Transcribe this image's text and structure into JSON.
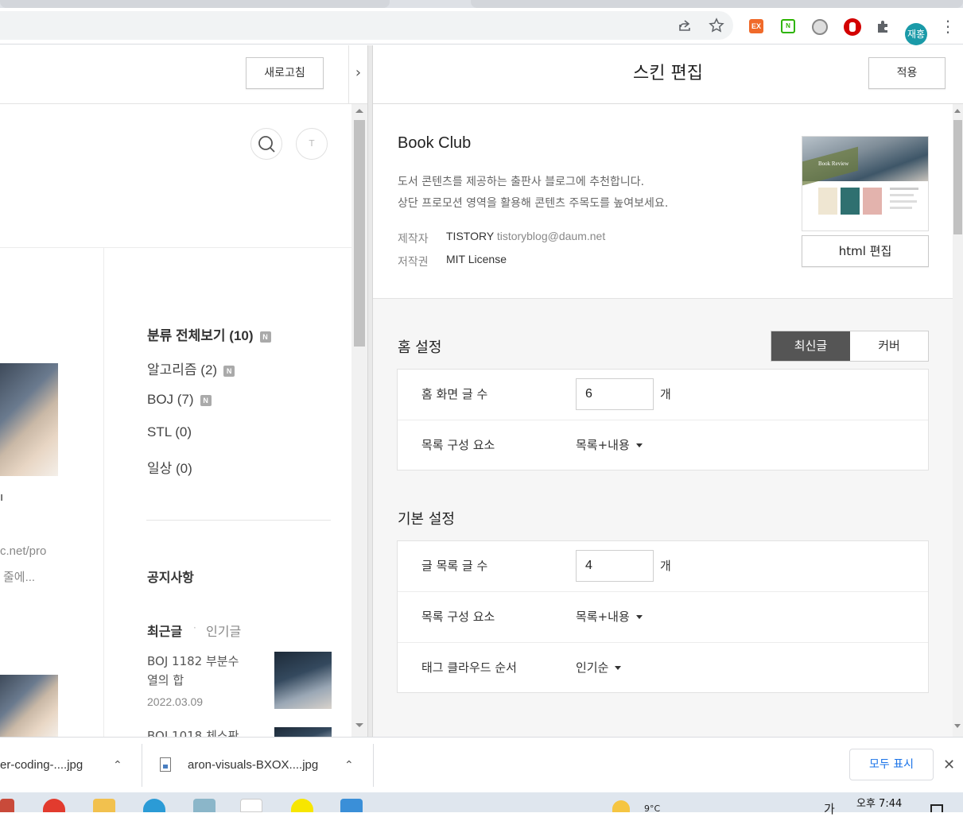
{
  "browser": {
    "profile_label": "재홍",
    "extensions": [
      {
        "name": "ex-extension-icon",
        "label": "EX",
        "color": "#f06a2a"
      },
      {
        "name": "naver-extension-icon",
        "label": "N",
        "color": "#2db400"
      },
      {
        "name": "globe-extension-icon",
        "label": "",
        "color": "#777777"
      },
      {
        "name": "adblock-extension-icon",
        "label": "",
        "color": "#d30000"
      }
    ]
  },
  "preview": {
    "refresh_label": "새로고침",
    "search_icon": "search-icon",
    "t_icon_label": "T",
    "categories": [
      {
        "label": "분류 전체보기 (10)",
        "badge": "N"
      },
      {
        "label": "알고리즘 (2)",
        "badge": "N"
      },
      {
        "label": "BOJ (7)",
        "badge": "N"
      },
      {
        "label": "STL (0)",
        "badge": ""
      },
      {
        "label": "일상 (0)",
        "badge": ""
      }
    ],
    "partial_texts": {
      "line1": "ı",
      "line2": "c.net/pro",
      "line3": "줄에..."
    },
    "notice_title": "공지사항",
    "tabs": {
      "recent": "최근글",
      "separator": "·",
      "popular": "인기글"
    },
    "recent_post": {
      "title_line1": "BOJ 1182 부분수",
      "title_line2": "열의 합",
      "date": "2022.03.09"
    },
    "next_post_partial": "BOJ 1018 체스판"
  },
  "editor": {
    "title": "스킨 편집",
    "apply_label": "적용",
    "skin": {
      "name": "Book Club",
      "description_line1": "도서 콘텐츠를 제공하는 출판사 블로그에 추천합니다.",
      "description_line2": "상단 프로모션 영역을 활용해 콘텐츠 주목도를 높여보세요.",
      "maker_label": "제작자",
      "maker_value": "TISTORY",
      "maker_email": "tistoryblog@daum.net",
      "license_label": "저작권",
      "license_value": "MIT License",
      "thumb_caption": "Book Review",
      "html_edit_label": "html 편집"
    },
    "home": {
      "title": "홈 설정",
      "seg_latest": "최신글",
      "seg_cover": "커버",
      "post_count_label": "홈 화면 글 수",
      "post_count_value": "6",
      "unit": "개",
      "list_elements_label": "목록 구성 요소",
      "list_elements_value": "목록+내용"
    },
    "basic": {
      "title": "기본 설정",
      "post_count_label": "글 목록 글 수",
      "post_count_value": "4",
      "unit": "개",
      "list_elements_label": "목록 구성 요소",
      "list_elements_value": "목록+내용",
      "tag_order_label": "태그 클라우드 순서",
      "tag_order_value": "인기순"
    }
  },
  "downloads": {
    "item1": "er-coding-....jpg",
    "item2": "aron-visuals-BXOX....jpg",
    "show_all": "모두 표시"
  },
  "taskbar": {
    "time_line1": "오후 7:44",
    "temp": "9°C",
    "ime": "가"
  }
}
